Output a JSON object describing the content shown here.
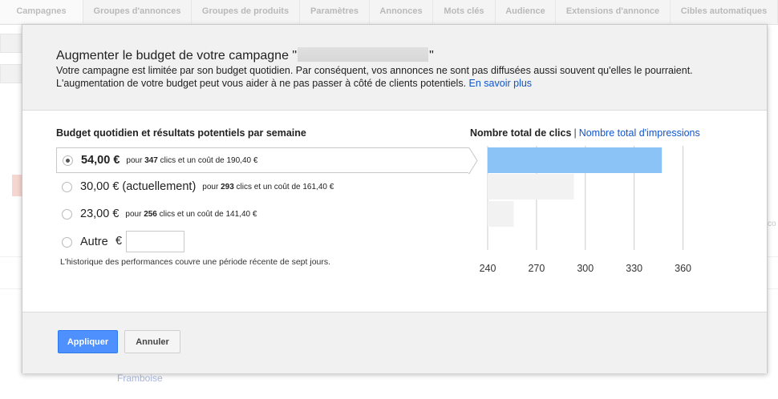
{
  "background": {
    "tabs": [
      {
        "label": "Campagnes",
        "active": true
      },
      {
        "label": "Groupes d'annonces"
      },
      {
        "label": "Groupes de produits"
      },
      {
        "label": "Paramètres"
      },
      {
        "label": "Annonces"
      },
      {
        "label": "Mots clés"
      },
      {
        "label": "Audience"
      },
      {
        "label": "Extensions d'annonce"
      },
      {
        "label": "Cibles automatiques"
      }
    ],
    "row_label": "Framboise",
    "truncated_text": "co"
  },
  "dialog": {
    "title_prefix": "Augmenter le budget de votre campagne \"",
    "title_suffix": "\"",
    "description": "Votre campagne est limitée par son budget quotidien. Par conséquent, vos annonces ne sont pas diffusées aussi souvent qu'elles le pourraient. L'augmentation de votre budget peut vous aider à ne pas passer à côté de clients potentiels.",
    "learn_more": "En savoir plus",
    "section_title": "Budget quotidien et résultats potentiels par semaine",
    "options": [
      {
        "amount": "54,00 €",
        "prefix": "pour",
        "clicks": "347",
        "suffix": "clics et un coût de 190,40 €",
        "selected": true
      },
      {
        "amount": "30,00 € (actuellement)",
        "prefix": "pour",
        "clicks": "293",
        "suffix": "clics et un coût de 161,40 €",
        "selected": false
      },
      {
        "amount": "23,00 €",
        "prefix": "pour",
        "clicks": "256",
        "suffix": "clics et un coût de 141,40 €",
        "selected": false
      }
    ],
    "other_label": "Autre",
    "other_currency": "€",
    "other_value": "",
    "history_note": "L'historique des performances couvre une période récente de sept jours.",
    "metric_tab_active": "Nombre total de clics",
    "metric_separator": "|",
    "metric_tab_link": "Nombre total d'impressions",
    "apply_label": "Appliquer",
    "cancel_label": "Annuler"
  },
  "chart_data": {
    "type": "bar",
    "orientation": "horizontal",
    "categories": [
      "54,00 €",
      "30,00 € (actuellement)",
      "23,00 €"
    ],
    "values": [
      347,
      293,
      256
    ],
    "xlim": [
      240,
      360
    ],
    "xticks": [
      "240",
      "270",
      "300",
      "330",
      "360"
    ],
    "grid": true,
    "colors": {
      "selected": "#8cc3f6",
      "other": "#f2f2f2",
      "grid": "#cccccc"
    }
  }
}
